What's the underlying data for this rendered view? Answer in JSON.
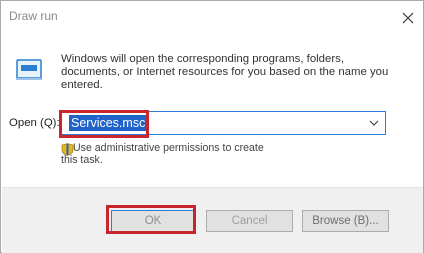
{
  "dialog": {
    "title": "Draw run",
    "description": "Windows will open the corresponding programs, folders, documents, or Internet resources for you based on the name you entered.",
    "open_label": "Open (Q):",
    "open_value": "Services.msc",
    "admin_note": "Use administrative permissions to create this task."
  },
  "buttons": {
    "ok": "OK",
    "cancel": "Cancel",
    "browse": "Browse (B)..."
  },
  "colors": {
    "highlight_box": "#c8262d",
    "selection": "#1f62c9",
    "accent_border": "#2a7ed3"
  },
  "icons": {
    "close": "close-icon",
    "run": "run-icon",
    "dropdown": "chevron-down-icon",
    "admin": "shield-icon"
  }
}
